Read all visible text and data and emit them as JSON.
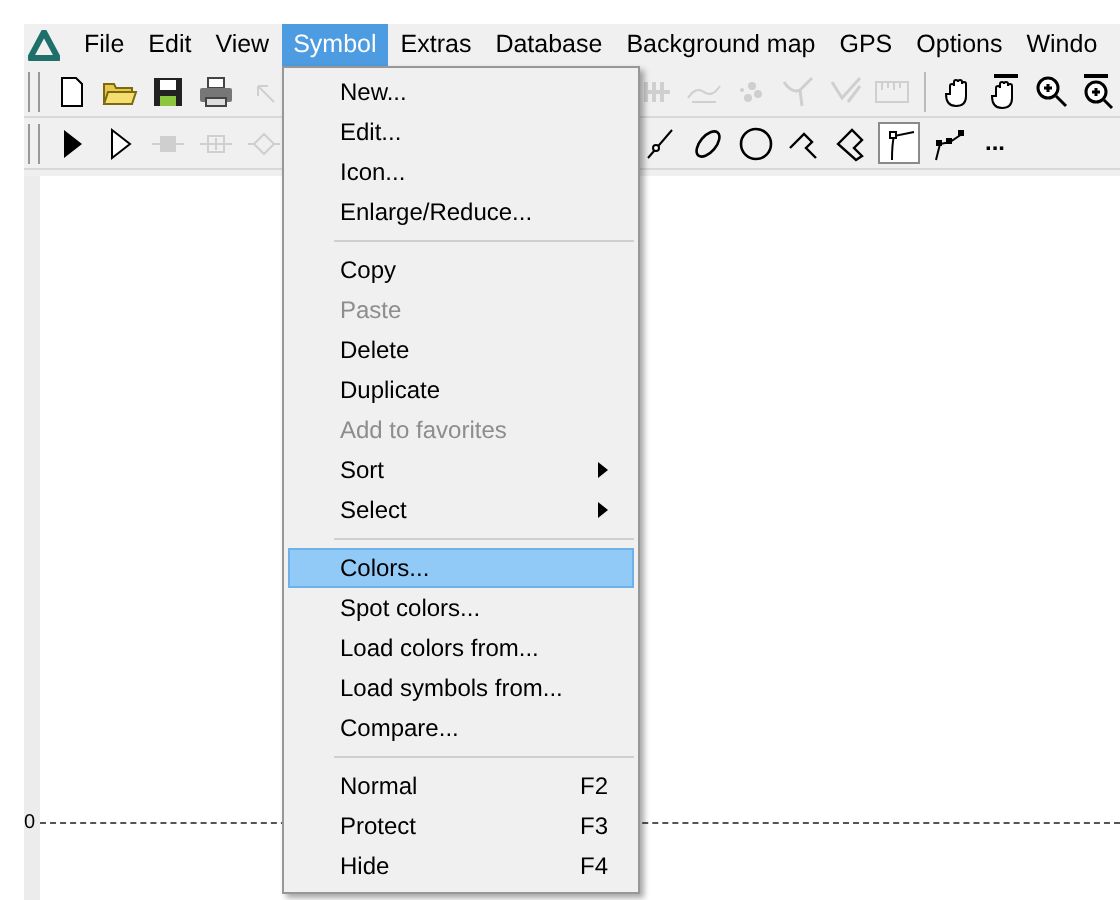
{
  "menu_bar": [
    {
      "label": "File",
      "selected": false
    },
    {
      "label": "Edit",
      "selected": false
    },
    {
      "label": "View",
      "selected": false
    },
    {
      "label": "Symbol",
      "selected": true
    },
    {
      "label": "Extras",
      "selected": false
    },
    {
      "label": "Database",
      "selected": false
    },
    {
      "label": "Background map",
      "selected": false
    },
    {
      "label": "GPS",
      "selected": false
    },
    {
      "label": "Options",
      "selected": false
    },
    {
      "label": "Windo",
      "selected": false
    }
  ],
  "toolbar_1": {
    "left": [
      {
        "kind": "new",
        "disabled": false
      },
      {
        "kind": "open",
        "disabled": false
      },
      {
        "kind": "save",
        "disabled": false
      },
      {
        "kind": "print",
        "disabled": false
      },
      {
        "kind": "undo",
        "disabled": true
      }
    ],
    "right": [
      {
        "kind": "join",
        "disabled": true
      },
      {
        "kind": "smooth",
        "disabled": true
      },
      {
        "kind": "scatter",
        "disabled": true
      },
      {
        "kind": "split",
        "disabled": true
      },
      {
        "kind": "pen",
        "disabled": true
      },
      {
        "kind": "ruler",
        "disabled": true
      },
      {
        "kind": "sep"
      },
      {
        "kind": "hand",
        "disabled": false
      },
      {
        "kind": "hand-bar",
        "disabled": false
      },
      {
        "kind": "zoom-in",
        "disabled": false
      },
      {
        "kind": "zoom-bar",
        "disabled": false
      }
    ]
  },
  "toolbar_2": {
    "left": [
      {
        "kind": "arrow",
        "selected": false,
        "disabled": false
      },
      {
        "kind": "hollow-arrow",
        "selected": false,
        "disabled": false
      },
      {
        "kind": "node-filled",
        "selected": false,
        "disabled": true
      },
      {
        "kind": "node-plus",
        "selected": false,
        "disabled": true
      },
      {
        "kind": "node-diamond",
        "selected": false,
        "disabled": true
      }
    ],
    "right": [
      {
        "kind": "line-node",
        "selected": false,
        "disabled": false
      },
      {
        "kind": "ellipse",
        "selected": false,
        "disabled": false
      },
      {
        "kind": "circle",
        "selected": false,
        "disabled": false
      },
      {
        "kind": "corner",
        "selected": false,
        "disabled": false
      },
      {
        "kind": "polygon",
        "selected": false,
        "disabled": false
      },
      {
        "kind": "curve",
        "selected": true,
        "disabled": false
      },
      {
        "kind": "polyline",
        "selected": false,
        "disabled": false
      },
      {
        "kind": "more",
        "label": "..."
      }
    ]
  },
  "canvas": {
    "ruler_label": "0"
  },
  "symbol_menu": [
    {
      "kind": "item",
      "label": "New...",
      "disabled": false,
      "selected": false
    },
    {
      "kind": "item",
      "label": "Edit...",
      "disabled": false,
      "selected": false
    },
    {
      "kind": "item",
      "label": "Icon...",
      "disabled": false,
      "selected": false
    },
    {
      "kind": "item",
      "label": "Enlarge/Reduce...",
      "disabled": false,
      "selected": false
    },
    {
      "kind": "separator"
    },
    {
      "kind": "item",
      "label": "Copy",
      "disabled": false,
      "selected": false
    },
    {
      "kind": "item",
      "label": "Paste",
      "disabled": true,
      "selected": false
    },
    {
      "kind": "item",
      "label": "Delete",
      "disabled": false,
      "selected": false
    },
    {
      "kind": "item",
      "label": "Duplicate",
      "disabled": false,
      "selected": false
    },
    {
      "kind": "item",
      "label": "Add to favorites",
      "disabled": true,
      "selected": false
    },
    {
      "kind": "submenu",
      "label": "Sort",
      "disabled": false,
      "selected": false
    },
    {
      "kind": "submenu",
      "label": "Select",
      "disabled": false,
      "selected": false
    },
    {
      "kind": "separator"
    },
    {
      "kind": "item",
      "label": "Colors...",
      "disabled": false,
      "selected": true
    },
    {
      "kind": "item",
      "label": "Spot colors...",
      "disabled": false,
      "selected": false
    },
    {
      "kind": "item",
      "label": "Load colors from...",
      "disabled": false,
      "selected": false
    },
    {
      "kind": "item",
      "label": "Load symbols from...",
      "disabled": false,
      "selected": false
    },
    {
      "kind": "item",
      "label": "Compare...",
      "disabled": false,
      "selected": false
    },
    {
      "kind": "separator"
    },
    {
      "kind": "item",
      "label": "Normal",
      "shortcut": "F2",
      "disabled": false,
      "selected": false
    },
    {
      "kind": "item",
      "label": "Protect",
      "shortcut": "F3",
      "disabled": false,
      "selected": false
    },
    {
      "kind": "item",
      "label": "Hide",
      "shortcut": "F4",
      "disabled": false,
      "selected": false
    }
  ]
}
